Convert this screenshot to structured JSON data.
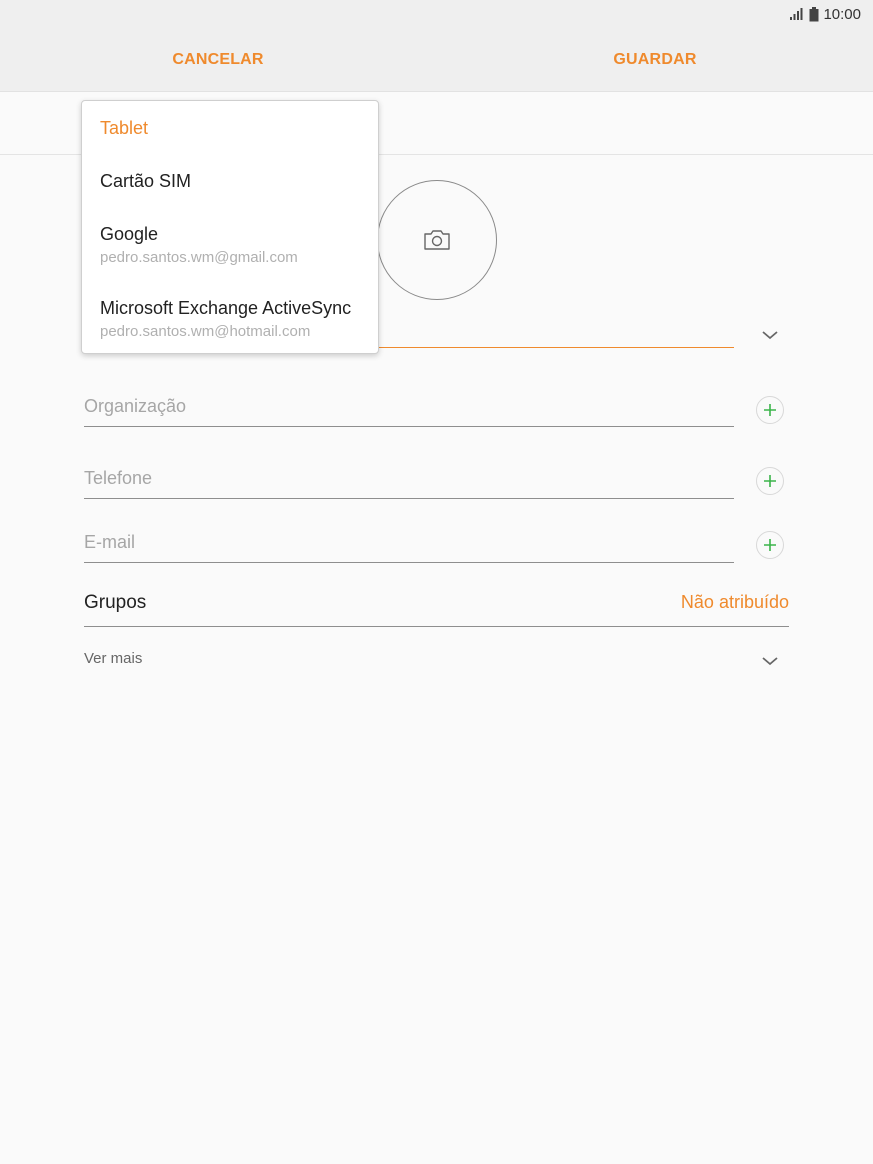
{
  "status_bar": {
    "time": "10:00",
    "icons": [
      "signal-icon",
      "battery-icon"
    ]
  },
  "action_bar": {
    "cancel_label": "CANCELAR",
    "save_label": "GUARDAR"
  },
  "storage_menu": {
    "items": [
      {
        "title": "Tablet",
        "subtitle": "",
        "selected": true
      },
      {
        "title": "Cartão SIM",
        "subtitle": "",
        "selected": false
      },
      {
        "title": "Google",
        "subtitle": "pedro.santos.wm@gmail.com",
        "selected": false
      },
      {
        "title": "Microsoft Exchange ActiveSync",
        "subtitle": "pedro.santos.wm@hotmail.com",
        "selected": false
      }
    ]
  },
  "form": {
    "photo_icon": "camera-icon",
    "organization_placeholder": "Organização",
    "phone_placeholder": "Telefone",
    "email_placeholder": "E-mail",
    "groups_label": "Grupos",
    "groups_value": "Não atribuído",
    "more_label": "Ver mais"
  },
  "colors": {
    "accent": "#ef8a2d",
    "add": "#3bb54a"
  }
}
